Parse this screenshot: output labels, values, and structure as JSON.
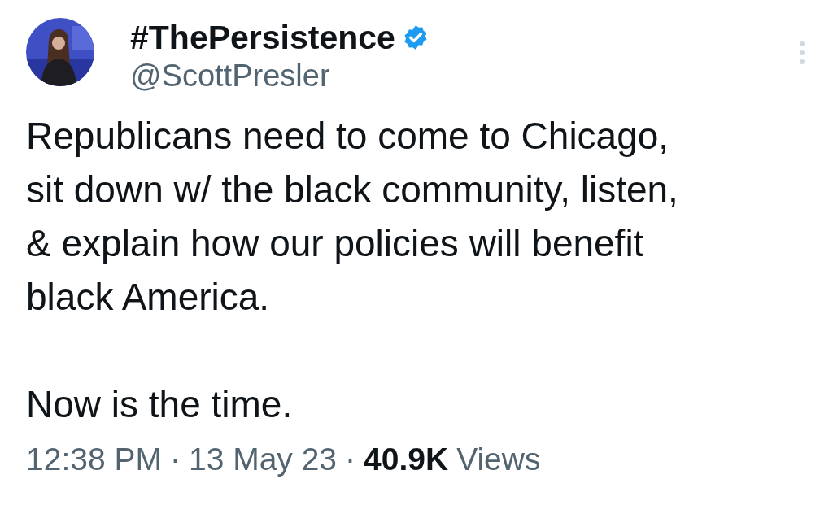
{
  "author": {
    "display_name": "#ThePersistence",
    "verified": true,
    "handle": "@ScottPresler"
  },
  "post": {
    "paragraphs": [
      {
        "lines": [
          "Republicans need to come to Chicago,",
          "sit down w/ the black community, listen,",
          "& explain how our policies will benefit",
          "black America."
        ]
      },
      {
        "lines": [
          "Now is the time."
        ]
      }
    ]
  },
  "meta": {
    "time": "12:38 PM",
    "separator_1": "·",
    "date": "13 May 23",
    "separator_2": "·",
    "views_count": "40.9K",
    "views_label": "Views"
  }
}
